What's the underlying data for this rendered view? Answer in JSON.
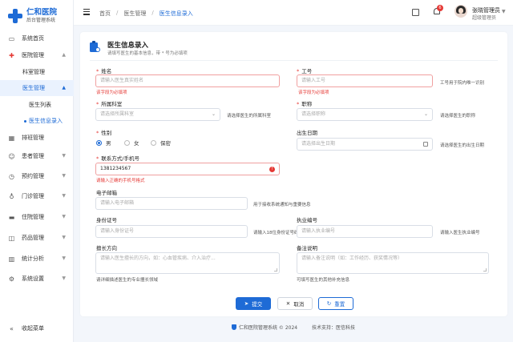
{
  "brand": {
    "title": "仁和医院",
    "subtitle": "后台管理系统"
  },
  "sidebar": {
    "items": [
      {
        "label": "系统首页",
        "icon": "desktop-icon"
      },
      {
        "label": "医院管理",
        "icon": "hospital-icon"
      },
      {
        "label": "科室管理"
      },
      {
        "label": "医生管理"
      },
      {
        "label": "医生列表"
      },
      {
        "label": "医生信息录入"
      },
      {
        "label": "排班管理",
        "icon": "calendar-icon"
      },
      {
        "label": "患者管理",
        "icon": "users-icon"
      },
      {
        "label": "预约管理",
        "icon": "clock-icon"
      },
      {
        "label": "门诊管理",
        "icon": "stethoscope-icon"
      },
      {
        "label": "住院管理",
        "icon": "bed-icon"
      },
      {
        "label": "药品管理",
        "icon": "pill-icon"
      },
      {
        "label": "统计分析",
        "icon": "chart-icon"
      },
      {
        "label": "系统设置",
        "icon": "gear-icon"
      }
    ],
    "collapse_label": "收起菜单"
  },
  "topbar": {
    "breadcrumb": [
      "首页",
      "医生管理",
      "医生信息录入"
    ],
    "notification_count": "6",
    "user_name": "张晓管理员",
    "user_role": "超级管理员"
  },
  "form": {
    "title": "医生信息录入",
    "subtitle": "请填写医生的基本信息，带 * 号为必填项",
    "name": {
      "label": "姓名",
      "placeholder": "请输入医生真实姓名",
      "error": "该字段为必填项"
    },
    "staff_id": {
      "label": "工号",
      "placeholder": "请输入工号",
      "error": "该字段为必填项",
      "hint": "工号用于院内唯一识别"
    },
    "department": {
      "label": "所属科室",
      "placeholder": "请选择所属科室",
      "hint": "请选择医生的所属科室"
    },
    "title_field": {
      "label": "职称",
      "placeholder": "请选择职称",
      "hint": "请选择医生的职称"
    },
    "gender": {
      "label": "性别",
      "options": [
        "男",
        "女",
        "保密"
      ],
      "selected": "男"
    },
    "birth": {
      "label": "出生日期",
      "placeholder": "请选择出生日期",
      "hint": "请选择医生的出生日期"
    },
    "phone": {
      "label": "联系方式/手机号",
      "value": "1381234567",
      "error": "请输入正确的手机号格式"
    },
    "email": {
      "label": "电子邮箱",
      "placeholder": "请输入电子邮箱",
      "hint": "用于接收系统通知与重要信息"
    },
    "id_card": {
      "label": "身份证号",
      "placeholder": "请输入身份证号",
      "hint": "请输入18位身份证号码"
    },
    "license": {
      "label": "执业编号",
      "placeholder": "请输入执业编号",
      "hint": "请输入医生执业编号"
    },
    "specialty": {
      "label": "擅长方向",
      "placeholder": "请输入医生擅长的方向，如：心血管疾病、介入治疗...",
      "hint": "请详细描述医生的专业擅长领域"
    },
    "remark": {
      "label": "备注说明",
      "placeholder": "请输入备注说明（如：工作经历、获奖情况等）",
      "hint": "可填写医生的其他补充信息"
    }
  },
  "actions": {
    "submit": "提交",
    "cancel": "取消",
    "reset": "重置"
  },
  "footer": {
    "copyright": "仁和医院管理系统 © 2024",
    "support": "技术支持：医信科技"
  },
  "colors": {
    "primary": "#1e6bd6",
    "error": "#e53935"
  }
}
